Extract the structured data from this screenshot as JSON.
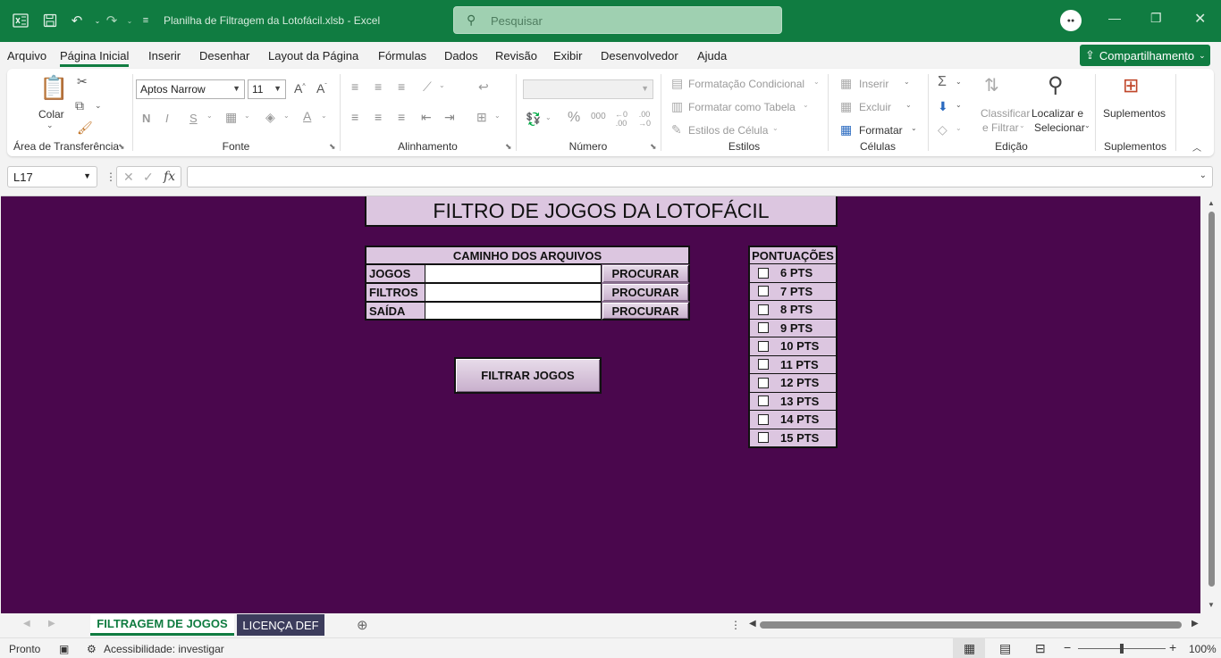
{
  "titlebar": {
    "doc_title": "Planilha de Filtragem da Lotofácil.xlsb  -  Excel",
    "search_placeholder": "Pesquisar"
  },
  "menu": {
    "items": [
      "Arquivo",
      "Página Inicial",
      "Inserir",
      "Desenhar",
      "Layout da Página",
      "Fórmulas",
      "Dados",
      "Revisão",
      "Exibir",
      "Desenvolvedor",
      "Ajuda"
    ],
    "active": "Página Inicial",
    "share_label": "Compartilhamento"
  },
  "ribbon": {
    "clipboard": {
      "paste_label": "Colar",
      "group_label": "Área de Transferência"
    },
    "font": {
      "font_name": "Aptos Narrow",
      "font_size": "11",
      "bold": "N",
      "italic": "I",
      "underline": "S",
      "group_label": "Fonte"
    },
    "alignment": {
      "group_label": "Alinhamento"
    },
    "number": {
      "format_value": "",
      "group_label": "Número"
    },
    "styles": {
      "conditional": "Formatação Condicional",
      "as_table": "Formatar como Tabela",
      "cell_styles": "Estilos de Célula",
      "group_label": "Estilos"
    },
    "cells": {
      "insert": "Inserir",
      "delete": "Excluir",
      "format": "Formatar",
      "group_label": "Células"
    },
    "editing": {
      "sort_filter_1": "Classificar",
      "sort_filter_2": "e Filtrar",
      "find_1": "Localizar e",
      "find_2": "Selecionar",
      "group_label": "Edição"
    },
    "addins": {
      "label": "Suplementos",
      "group_label": "Suplementos"
    }
  },
  "formula_bar": {
    "name_box": "L17",
    "formula": ""
  },
  "sheet": {
    "title": "FILTRO DE JOGOS DA LOTOFÁCIL",
    "paths_header": "CAMINHO DOS ARQUIVOS",
    "paths": [
      {
        "label": "JOGOS",
        "value": "",
        "button": "PROCURAR"
      },
      {
        "label": "FILTROS",
        "value": "",
        "button": "PROCURAR"
      },
      {
        "label": "SAÍDA",
        "value": "",
        "button": "PROCURAR"
      }
    ],
    "filter_button": "FILTRAR JOGOS",
    "scores_header": "PONTUAÇÕES",
    "scores": [
      "6 PTS",
      "7 PTS",
      "8 PTS",
      "9 PTS",
      "10 PTS",
      "11 PTS",
      "12 PTS",
      "13 PTS",
      "14 PTS",
      "15 PTS"
    ],
    "background_color": "#4a074d",
    "cell_color": "#dcc6e0"
  },
  "tabs": {
    "sheets": [
      "FILTRAGEM DE JOGOS",
      "LICENÇA DEF"
    ],
    "active": "FILTRAGEM DE JOGOS"
  },
  "status": {
    "ready": "Pronto",
    "accessibility": "Acessibilidade: investigar",
    "zoom": "100%"
  },
  "colors": {
    "accent": "#107c41"
  }
}
